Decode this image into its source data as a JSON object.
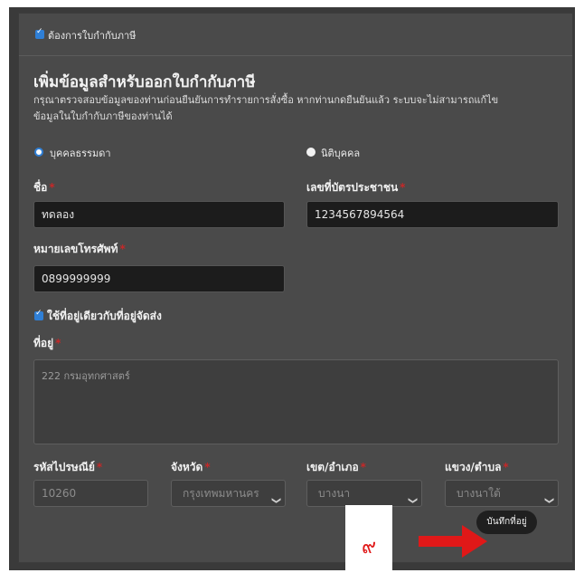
{
  "invoice_toggle": {
    "label": "ต้องการใบกำกับภาษี",
    "checked": true
  },
  "section": {
    "title": "เพิ่มข้อมูลสำหรับออกใบกำกับภาษี",
    "desc_line1": "กรุณาตรวจสอบข้อมูลของท่านก่อนยืนยันการทำรายการสั่งซื้อ หากท่านกดยืนยันแล้ว ระบบจะไม่สามารถแก้ไข",
    "desc_line2": "ข้อมูลในใบกำกับภาษีของท่านได้"
  },
  "entity_type": {
    "options": [
      {
        "label": "บุคคลธรรมดา",
        "selected": true
      },
      {
        "label": "นิติบุคคล",
        "selected": false
      }
    ]
  },
  "fields": {
    "name": {
      "label": "ชื่อ",
      "value": "ทดลอง"
    },
    "id_card": {
      "label": "เลขที่บัตรประชาชน",
      "value": "1234567894564"
    },
    "phone": {
      "label": "หมายเลขโทรศัพท์",
      "value": "0899999999"
    },
    "same_address": {
      "label": "ใช้ที่อยู่เดียวกับที่อยู่จัดส่ง",
      "checked": true
    },
    "address": {
      "label": "ที่อยู่",
      "value": "222 กรมอุทกศาสตร์"
    },
    "postcode": {
      "label": "รหัสไปรษณีย์",
      "value": "10260"
    },
    "province": {
      "label": "จังหวัด",
      "value": "กรุงเทพมหานคร"
    },
    "district": {
      "label": "เขต/อำเภอ",
      "value": "บางนา"
    },
    "subdistrict": {
      "label": "แขวง/ตำบล",
      "value": "บางนาใต้"
    }
  },
  "required_mark": "*",
  "save_button": {
    "label": "บันทึกที่อยู่"
  },
  "annotation": {
    "step_number": "๙",
    "color": "#e01818"
  },
  "colors": {
    "accent": "#2f7fd6",
    "required": "#c62828",
    "panel": "#4a4a4a"
  }
}
